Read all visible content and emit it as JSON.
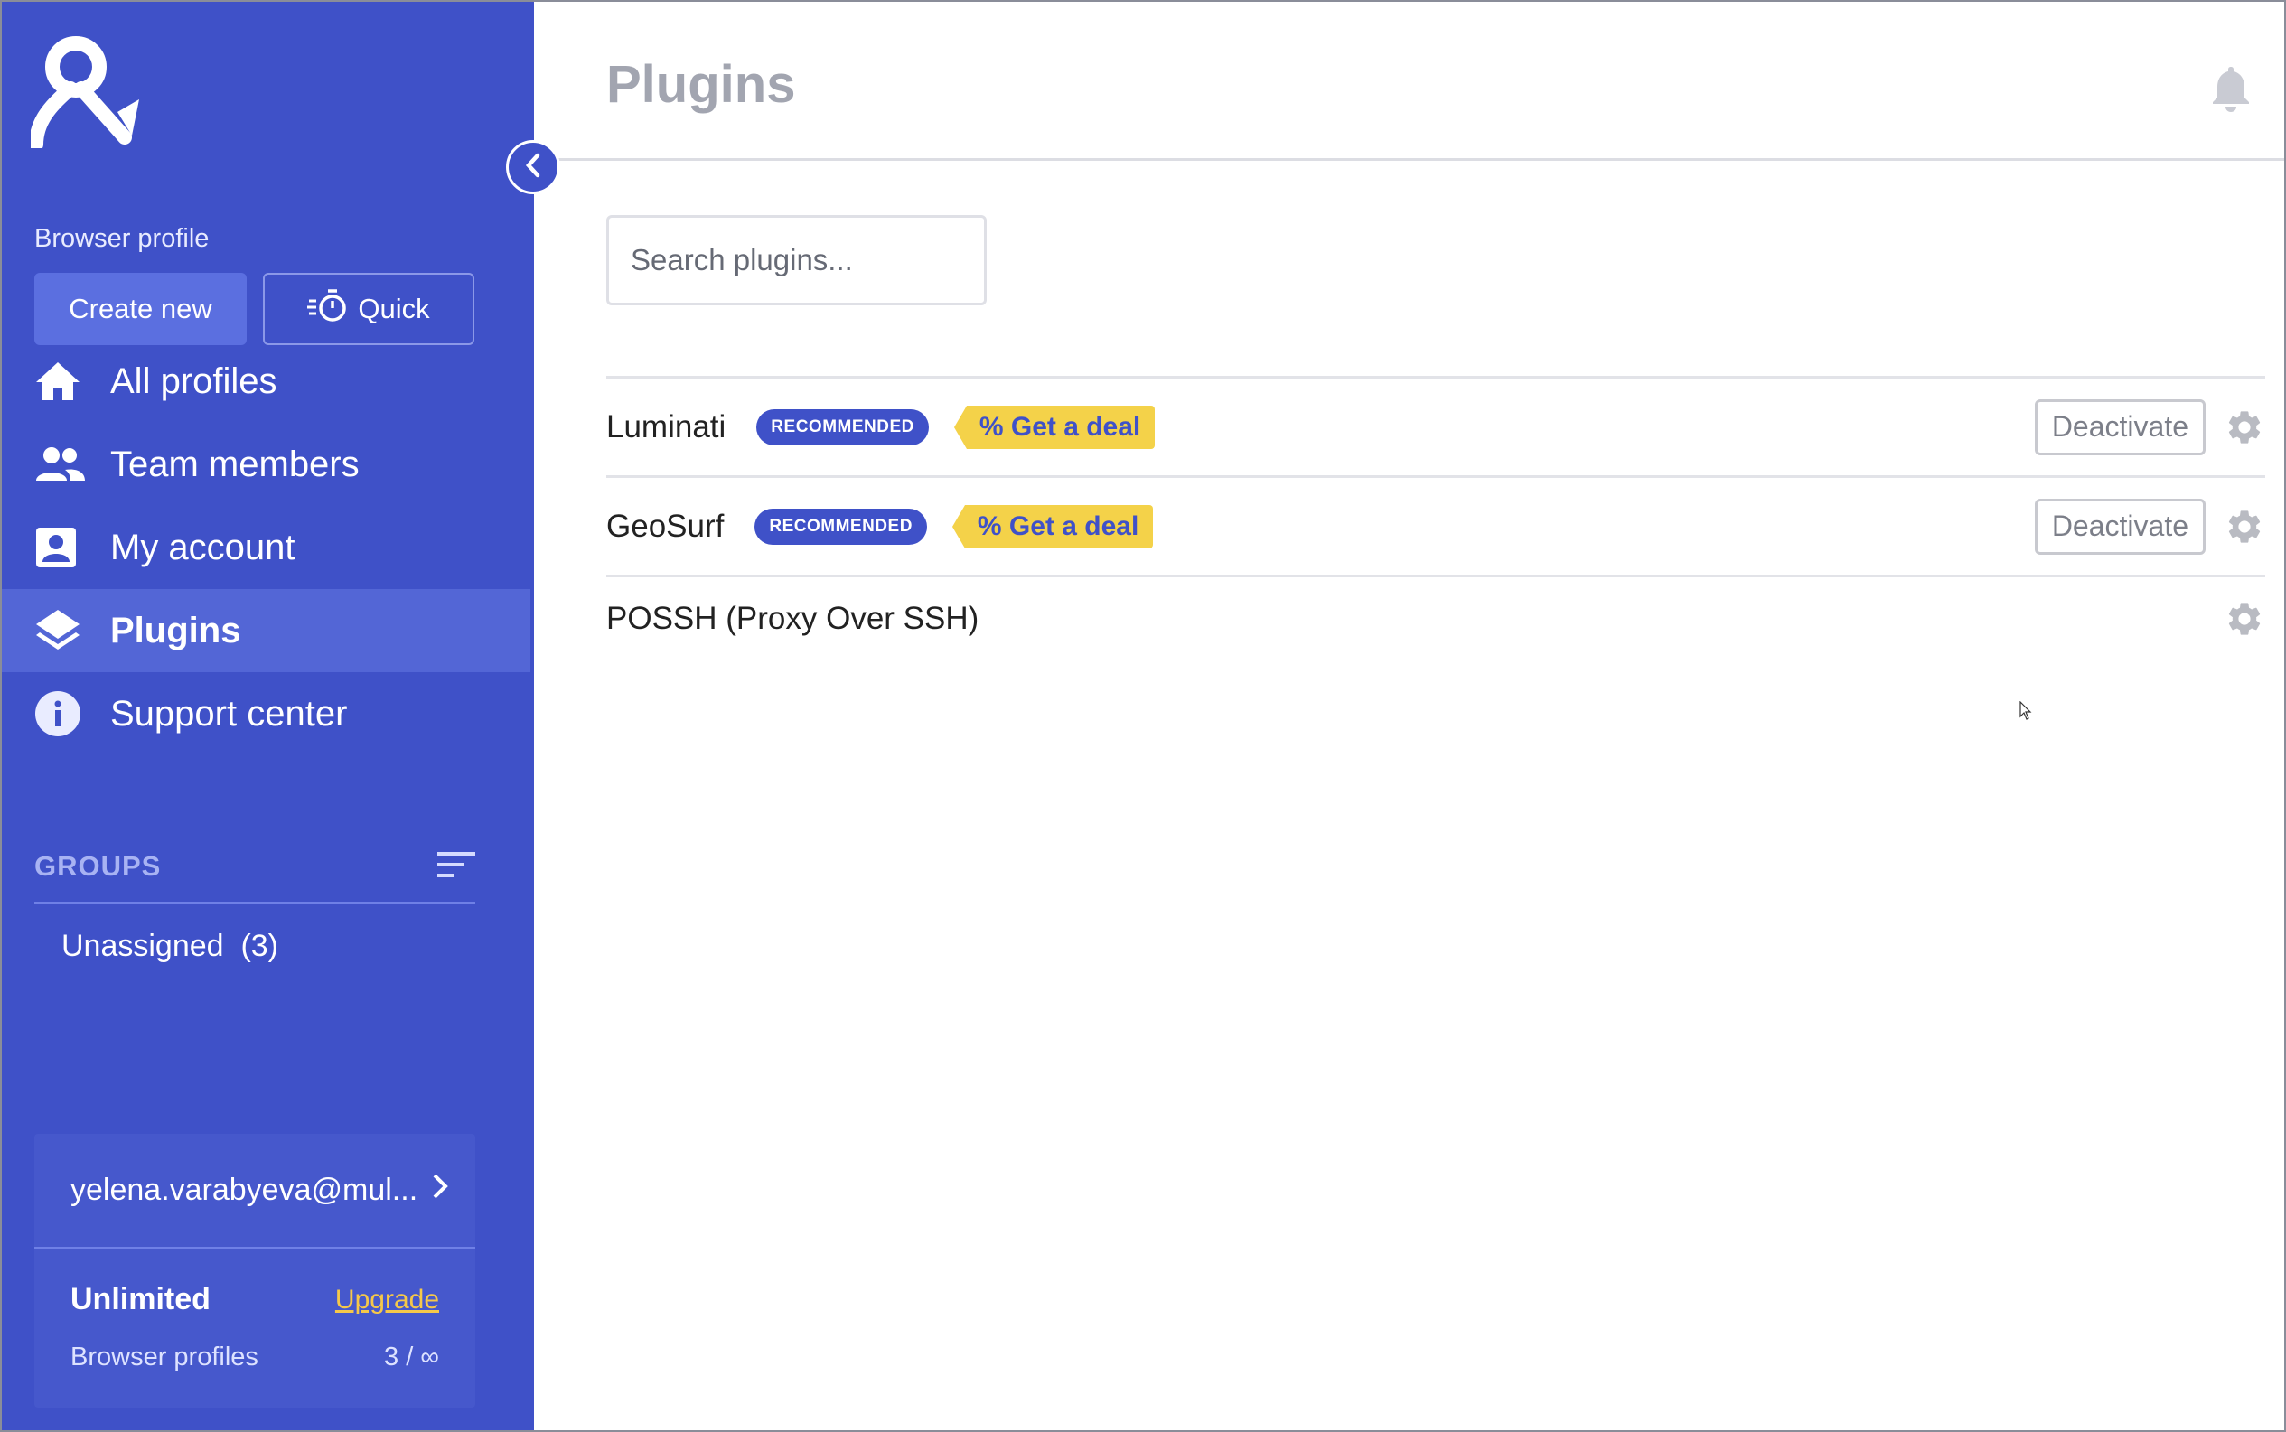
{
  "sidebar": {
    "browser_profile_label": "Browser profile",
    "create_new_label": "Create new",
    "quick_label": "Quick",
    "nav": [
      {
        "label": "All profiles",
        "icon": "home-icon"
      },
      {
        "label": "Team members",
        "icon": "people-icon"
      },
      {
        "label": "My account",
        "icon": "account-box-icon"
      },
      {
        "label": "Plugins",
        "icon": "layers-icon",
        "active": true
      },
      {
        "label": "Support center",
        "icon": "info-icon"
      }
    ],
    "groups": {
      "title": "GROUPS",
      "items": [
        {
          "label": "Unassigned  (3)"
        }
      ]
    },
    "account": {
      "email": "yelena.varabyeva@mul...",
      "plan": "Unlimited",
      "upgrade_label": "Upgrade",
      "quota_label": "Browser profiles",
      "quota_value": "3 / ∞"
    }
  },
  "header": {
    "title": "Plugins"
  },
  "search": {
    "placeholder": "Search plugins..."
  },
  "plugins": [
    {
      "name": "Luminati",
      "badge": "RECOMMENDED",
      "deal": "% Get a deal",
      "action": "Deactivate"
    },
    {
      "name": "GeoSurf",
      "badge": "RECOMMENDED",
      "deal": "% Get a deal",
      "action": "Deactivate"
    },
    {
      "name": "POSSH (Proxy Over SSH)"
    }
  ],
  "colors": {
    "sidebar_bg": "#3f51c8",
    "accent": "#3f51c8",
    "deal_bg": "#f4d249",
    "upgrade": "#f5c84a"
  }
}
